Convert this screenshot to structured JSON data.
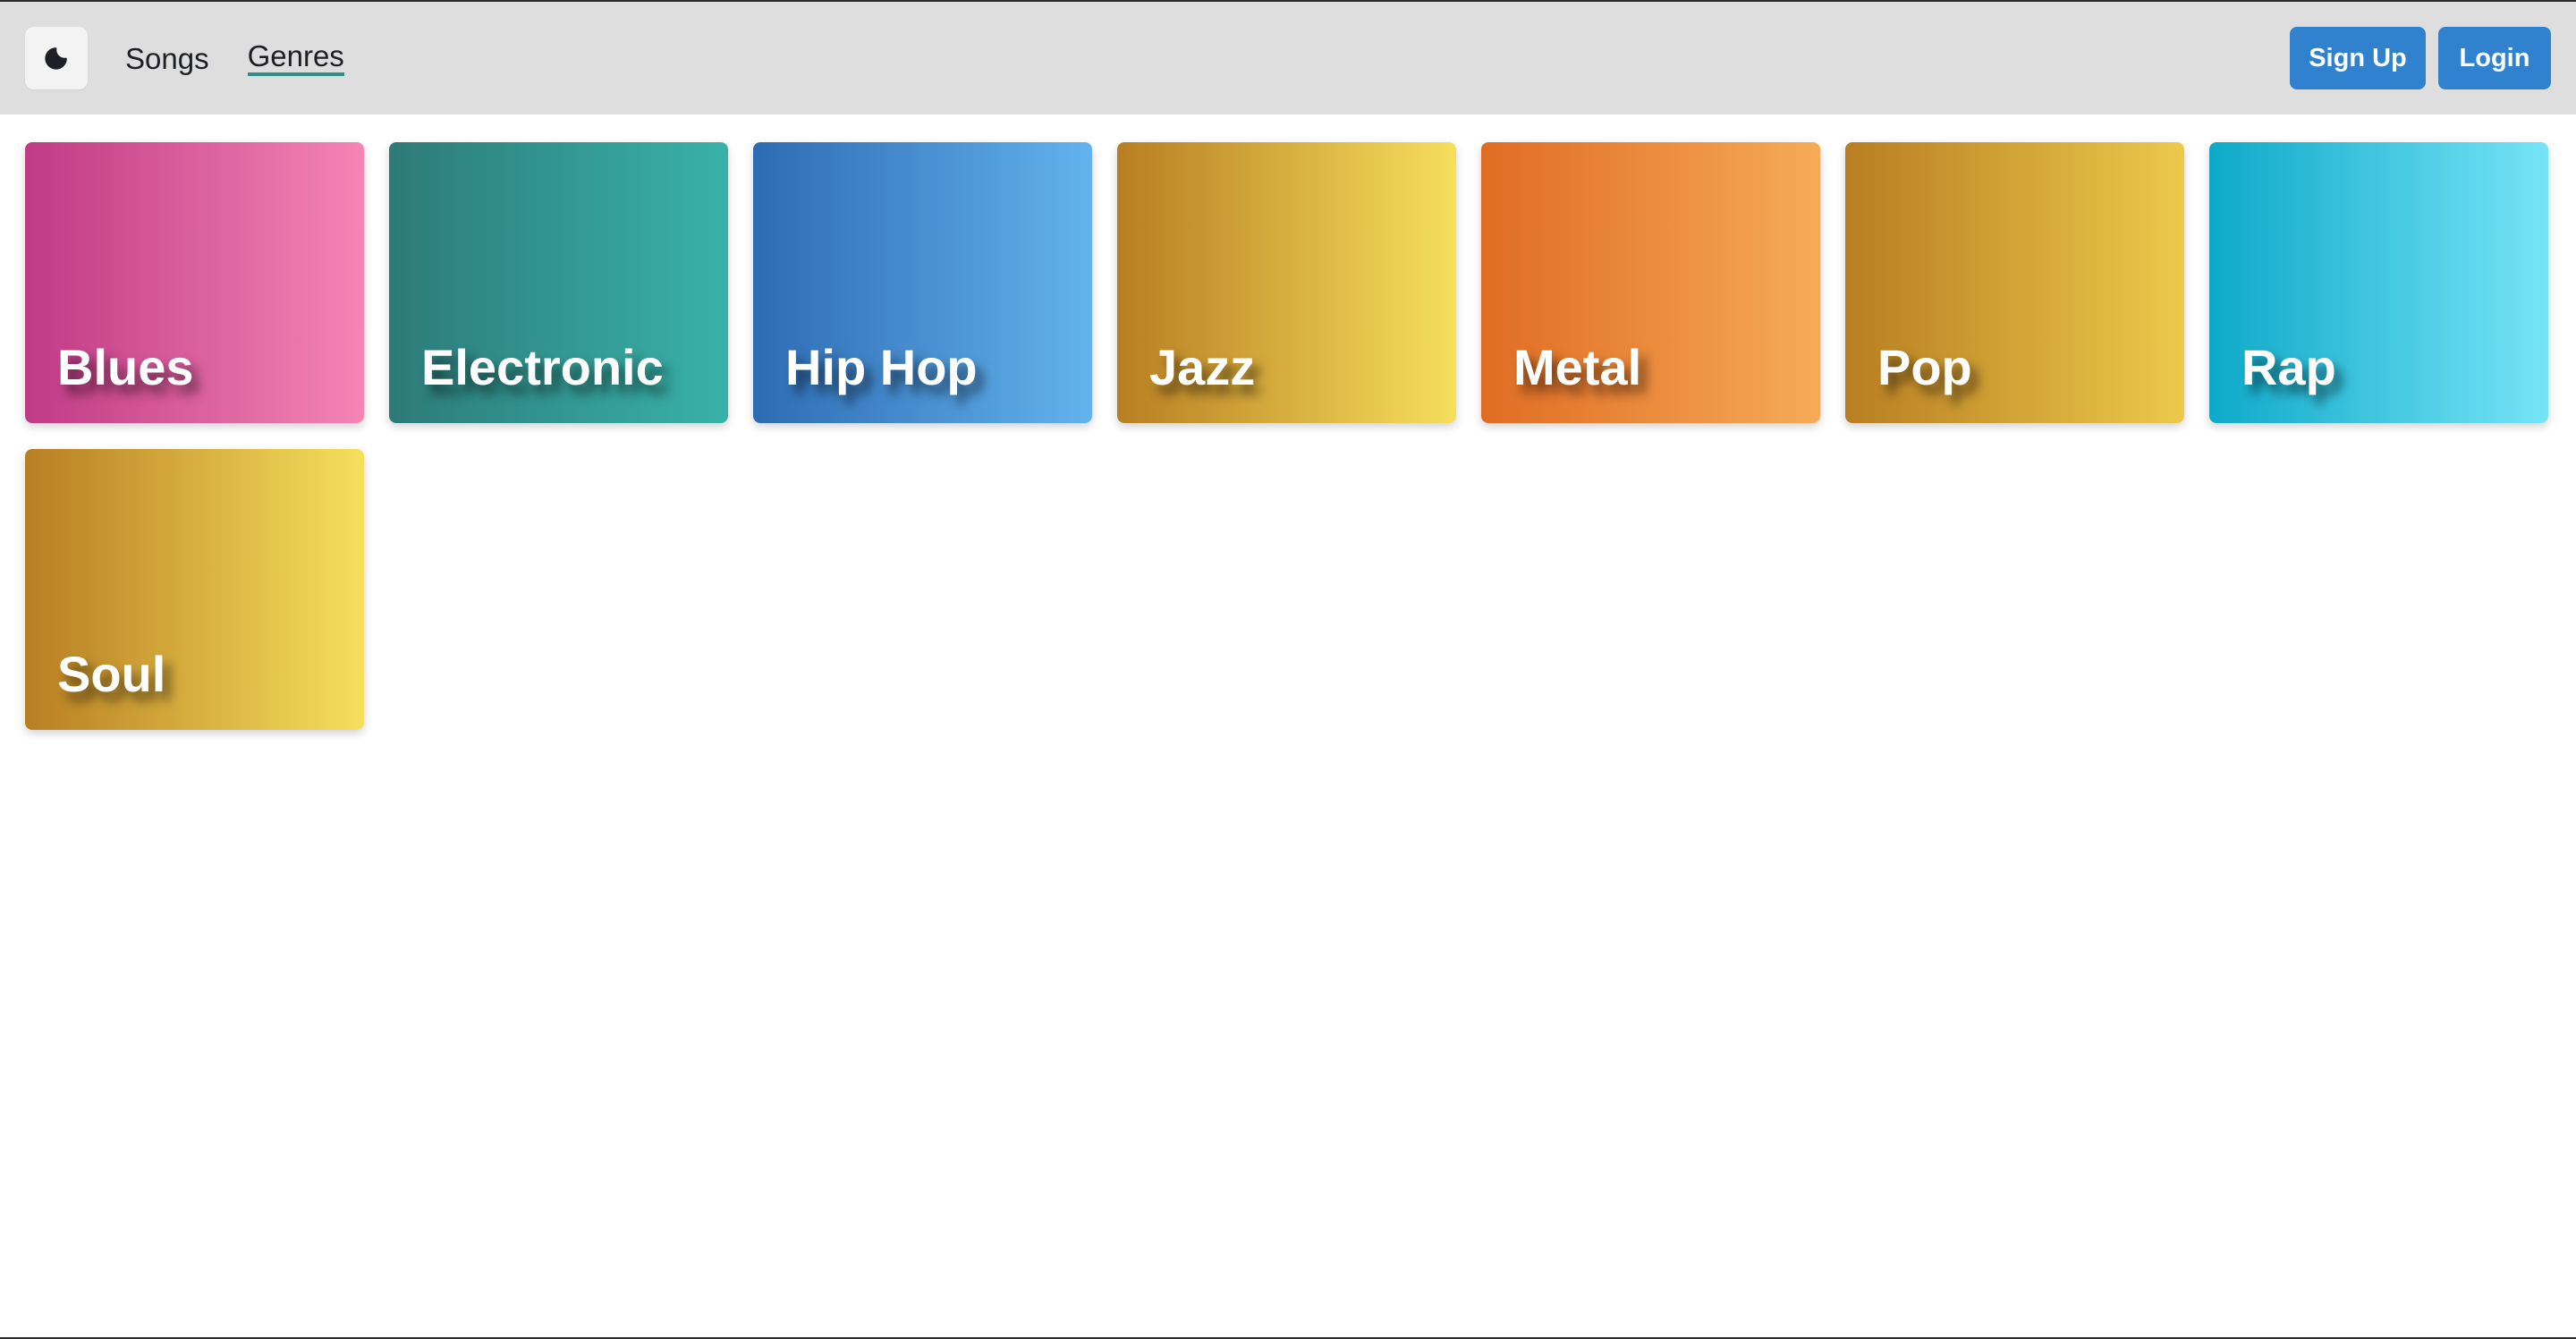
{
  "nav": {
    "theme_icon": "moon-icon",
    "links": [
      {
        "label": "Songs",
        "active": false
      },
      {
        "label": "Genres",
        "active": true
      }
    ],
    "signup_label": "Sign Up",
    "login_label": "Login",
    "accent_color": "#3182ce",
    "active_underline_color": "#2f8f8a"
  },
  "genres": [
    {
      "label": "Blues",
      "from": "#c03a85",
      "to": "#f585b5"
    },
    {
      "label": "Electronic",
      "from": "#2d7a78",
      "to": "#38b2a9"
    },
    {
      "label": "Hip Hop",
      "from": "#2d6bb3",
      "to": "#63b3ed"
    },
    {
      "label": "Jazz",
      "from": "#b87e22",
      "to": "#f6df5d"
    },
    {
      "label": "Metal",
      "from": "#e06c22",
      "to": "#f6ab58"
    },
    {
      "label": "Pop",
      "from": "#b87e22",
      "to": "#ecc94b"
    },
    {
      "label": "Rap",
      "from": "#0ea9c9",
      "to": "#76e4f7"
    },
    {
      "label": "Soul",
      "from": "#b87e22",
      "to": "#f6df5d"
    }
  ]
}
